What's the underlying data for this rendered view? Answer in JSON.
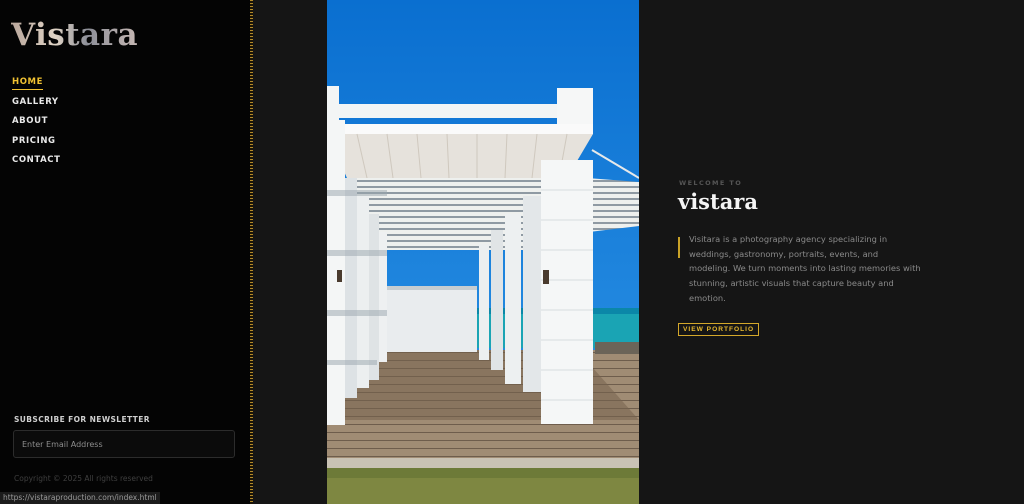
{
  "sidebar": {
    "logo": "Vistara",
    "nav": [
      {
        "label": "HOME",
        "active": true
      },
      {
        "label": "GALLERY",
        "active": false
      },
      {
        "label": "ABOUT",
        "active": false
      },
      {
        "label": "PRICING",
        "active": false
      },
      {
        "label": "CONTACT",
        "active": false
      }
    ],
    "newsletter": {
      "title": "SUBSCRIBE FOR NEWSLETTER",
      "email_placeholder": "Enter Email Address",
      "email_value": ""
    },
    "copyright": "Copyright © 2025 All rights reserved"
  },
  "status_bar": {
    "url": "https://vistaraproduction.com/index.html"
  },
  "hero": {
    "eyebrow": "WELCOME TO",
    "title": "vistara",
    "description": "Visitara is a photography agency specializing in weddings, gastronomy, portraits, events, and modeling. We turn moments into lasting memories with stunning, artistic visuals that capture beauty and emotion.",
    "cta_label": "VIEW PORTFOLIO"
  },
  "colors": {
    "accent": "#f1c232",
    "background": "#151515",
    "sidebar": "#040404"
  },
  "photo": {
    "subject": "white wooden pergola walkway by the sea"
  }
}
